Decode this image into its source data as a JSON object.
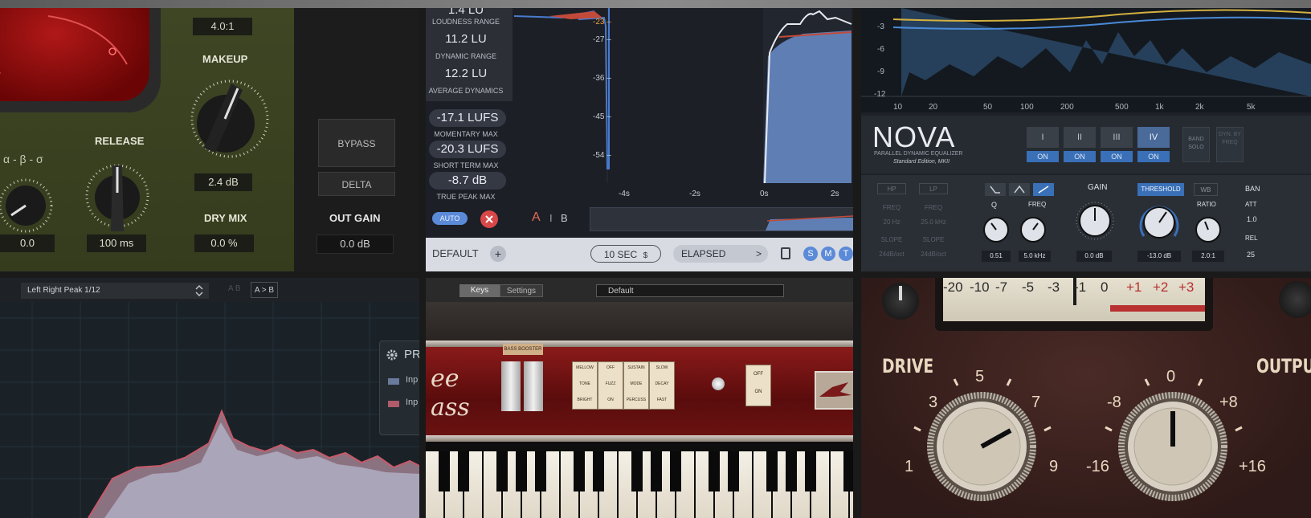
{
  "comp": {
    "ratio": "4.0:1",
    "makeup_label": "MAKEUP",
    "release_label": "RELEASE",
    "mode_chars": "α - β - σ",
    "makeup_value": "2.4 dB",
    "left_value": "0.0",
    "release_value": "100 ms",
    "drymix_label": "DRY MIX",
    "drymix_value": "0.0 %",
    "bypass": "BYPASS",
    "delta": "DELTA",
    "outgain_label": "OUT GAIN",
    "outgain_value": "0.0 dB"
  },
  "loudness": {
    "stats": [
      {
        "value": "1.4 LU",
        "label": "LOUDNESS RANGE"
      },
      {
        "value": "11.2 LU",
        "label": "DYNAMIC RANGE"
      },
      {
        "value": "12.2 LU",
        "label": "AVERAGE DYNAMICS"
      }
    ],
    "maxes": [
      {
        "value": "-17.1 LUFS",
        "label": "MOMENTARY MAX"
      },
      {
        "value": "-20.3 LUFS",
        "label": "SHORT TERM MAX"
      },
      {
        "value": "-8.7 dB",
        "label": "TRUE PEAK MAX"
      }
    ],
    "auto": "AUTO",
    "close_icon": "x-icon",
    "ab": [
      "A",
      "I",
      "B"
    ],
    "scale": [
      "-23 –",
      "-27 –",
      "-36 –",
      "-45 –",
      "-54 –"
    ],
    "time_axis": [
      "-4s",
      "-2s",
      "0s",
      "2s"
    ],
    "preset": "DEFAULT",
    "plus": "+",
    "window": "10 SEC",
    "stepper": "$",
    "elapsed": "ELAPSED",
    "elapsed_arrow": ">",
    "smt": [
      "S",
      "M",
      "T"
    ],
    "accent": "#5a8ad8"
  },
  "nova": {
    "y_axis": [
      "-3",
      "-6",
      "-9",
      "-12"
    ],
    "x_axis": [
      "10",
      "20",
      "50",
      "100",
      "200",
      "500",
      "1k",
      "2k",
      "5k"
    ],
    "title": "NOVA",
    "subtitle": "PARALLEL DYNAMIC EQUALIZER",
    "edition": "Standard Edition, MKII",
    "bands": [
      "I",
      "II",
      "III",
      "IV"
    ],
    "on": "ON",
    "band_solo": "BAND SOLO",
    "dyn_freq": "DYN. BY FREQ",
    "hp": "HP",
    "lp": "LP",
    "freq": "FREQ",
    "hp_freq": "20 Hz",
    "lp_freq": "25.0 kHz",
    "slope": "SLOPE",
    "hp_slope": "24dB/oct",
    "lp_slope": "24dB/oct",
    "gain_label": "GAIN",
    "threshold": "THRESHOLD",
    "wb": "WB",
    "band_label": "BAN",
    "q_label": "Q",
    "ratio_label": "RATIO",
    "att_label": "ATT",
    "att_value": "1.0",
    "rel_label": "REL",
    "rel_value": "25",
    "q_value": "0.51",
    "freq_value": "5.0 kHz",
    "gain_value": "0.0 dB",
    "threshold_value": "-13.0 dB",
    "ratio_value": "2.0:1"
  },
  "analyzer": {
    "mode": "Left Right Peak 1/12",
    "ab": "A B",
    "atob": "A > B",
    "legend_title": "PR",
    "legend_items": [
      "Inp",
      "Inp"
    ]
  },
  "piano": {
    "tab_keys": "Keys",
    "tab_settings": "Settings",
    "preset": "Default",
    "bass_booster": "BASS BOOSTER",
    "logo": "ee ass",
    "rocker_tops": [
      "MELLOW",
      "OFF",
      "SUSTAIN",
      "SLOW"
    ],
    "rocker_mids": [
      "TONE",
      "FUZZ",
      "MODE",
      "DECAY"
    ],
    "rocker_bots": [
      "BRIGHT",
      "ON",
      "PERCUSS",
      "FAST"
    ],
    "switch_off": "OFF",
    "switch_on": "ON"
  },
  "drive": {
    "vu_scale": [
      "-20",
      "-10",
      "-7",
      "-5",
      "-3",
      "-1",
      "0",
      "+1",
      "+2",
      "+3"
    ],
    "drive_label": "DRIVE",
    "output_label": "OUTPU",
    "drive_scale": [
      "5",
      "3",
      "7",
      "1",
      "9"
    ],
    "output_scale": [
      "0",
      "-8",
      "+8",
      "-16",
      "+16"
    ]
  }
}
